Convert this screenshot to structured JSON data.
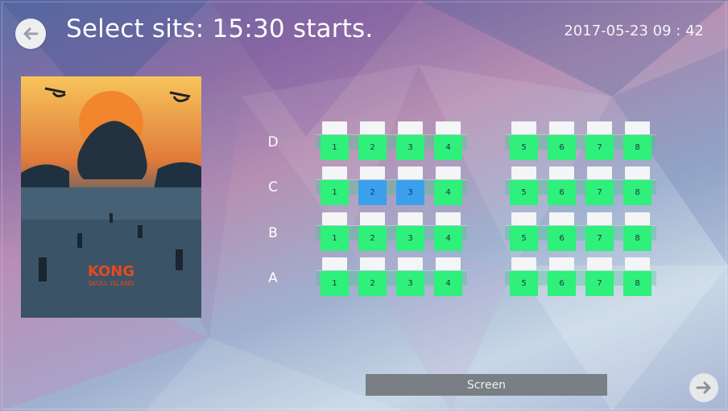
{
  "header": {
    "title": "Select sits: 15:30 starts.",
    "datetime": "2017-05-23  09 : 42",
    "back_icon": "arrow-left-icon",
    "next_icon": "arrow-right-icon"
  },
  "poster": {
    "title_line1": "KONG",
    "title_line2": "SKULL ISLAND"
  },
  "rows": [
    {
      "label": "D",
      "seats_left": [
        "1",
        "2",
        "3",
        "4"
      ],
      "seats_right": [
        "5",
        "6",
        "7",
        "8"
      ],
      "selected": []
    },
    {
      "label": "C",
      "seats_left": [
        "1",
        "2",
        "3",
        "4"
      ],
      "seats_right": [
        "5",
        "6",
        "7",
        "8"
      ],
      "selected": [
        "2",
        "3"
      ]
    },
    {
      "label": "B",
      "seats_left": [
        "1",
        "2",
        "3",
        "4"
      ],
      "seats_right": [
        "5",
        "6",
        "7",
        "8"
      ],
      "selected": []
    },
    {
      "label": "A",
      "seats_left": [
        "1",
        "2",
        "3",
        "4"
      ],
      "seats_right": [
        "5",
        "6",
        "7",
        "8"
      ],
      "selected": []
    }
  ],
  "screen_label": "Screen",
  "colors": {
    "seat_available": "#2ef07a",
    "seat_selected": "#3aa0ee",
    "seat_back": "#f4f5f7",
    "screen": "#7a7f86"
  }
}
